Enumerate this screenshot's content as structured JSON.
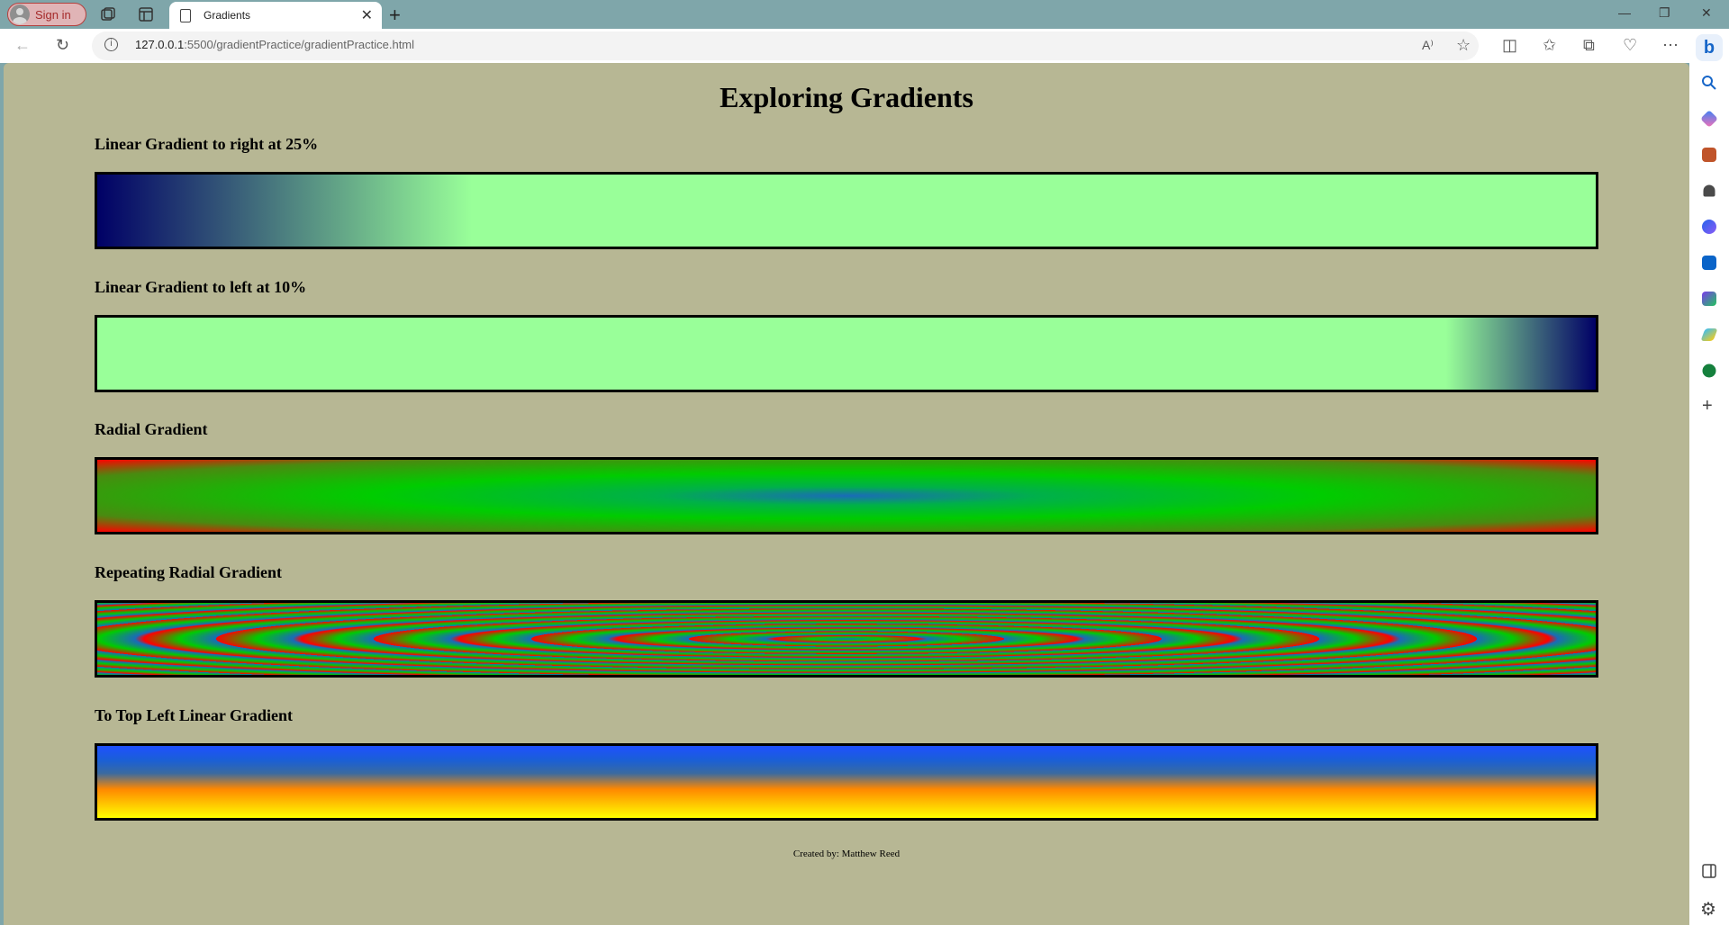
{
  "browser": {
    "signin_label": "Sign in",
    "tab_title": "Gradients",
    "url_host": "127.0.0.1",
    "url_path": ":5500/gradientPractice/gradientPractice.html",
    "colors": {
      "chrome": "#7fa6aa",
      "signin_border": "#b3423f"
    }
  },
  "page": {
    "title": "Exploring Gradients",
    "background": "#b7b794",
    "sections": [
      {
        "heading": "Linear Gradient to right at 25%"
      },
      {
        "heading": "Linear Gradient to left at 10%"
      },
      {
        "heading": "Radial Gradient"
      },
      {
        "heading": "Repeating Radial Gradient"
      },
      {
        "heading": "To Top Left Linear Gradient"
      }
    ],
    "footer": "Created by: Matthew Reed",
    "colors": {
      "navy": "#000066",
      "mint": "#99ff99",
      "red": "#ff0000",
      "green": "#00cc00",
      "blue": "#1a5fd6",
      "yellow": "#ffff00",
      "orange": "#ff8800"
    }
  },
  "sidebar_icons": [
    "search-icon",
    "tag-icon",
    "briefcase-icon",
    "chess-icon",
    "copilot-icon",
    "outlook-icon",
    "designer-icon",
    "send-icon",
    "tree-icon",
    "add-icon",
    "sidebar-toggle-icon",
    "settings-icon"
  ]
}
